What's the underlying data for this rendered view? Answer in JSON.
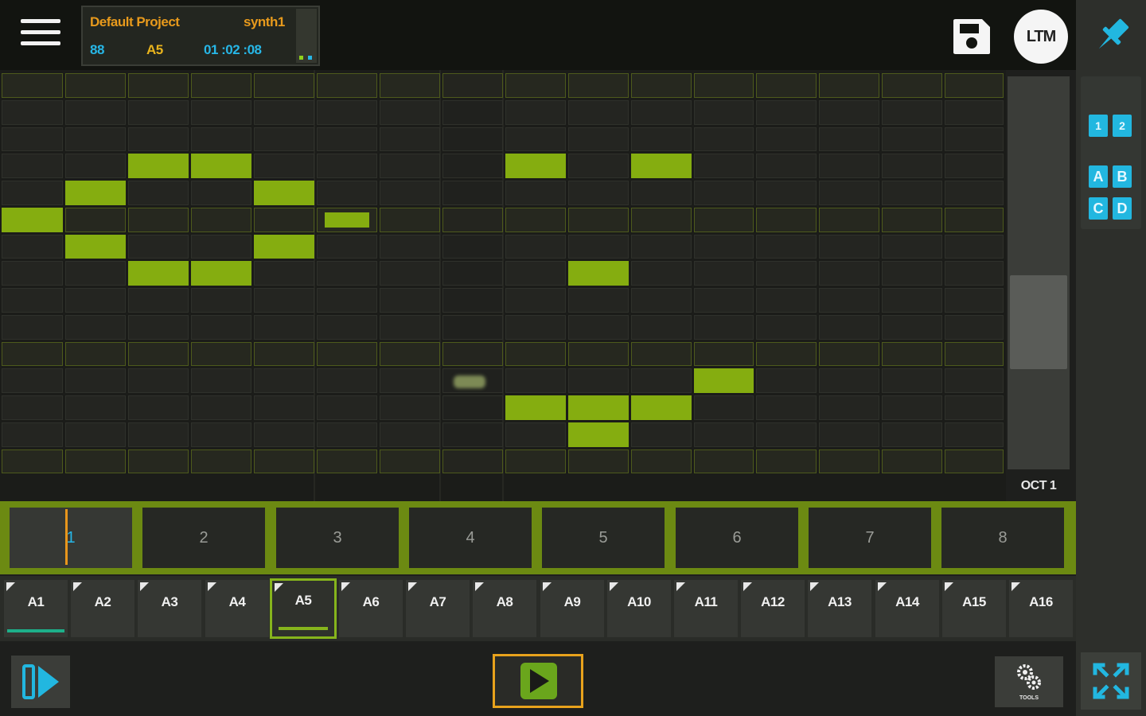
{
  "header": {
    "project_name": "Default Project",
    "instrument": "synth1",
    "bpm": "88",
    "pattern": "A5",
    "time": "01 :02 :08",
    "user_badge": "LTM"
  },
  "right_panel": {
    "page_buttons": [
      "1",
      "2"
    ],
    "bank_buttons": [
      "A",
      "B",
      "C",
      "D"
    ]
  },
  "piano_roll": {
    "rows": 15,
    "steps": 16,
    "notes": [
      {
        "row": 5,
        "step": 0
      },
      {
        "row": 4,
        "step": 1
      },
      {
        "row": 6,
        "step": 1
      },
      {
        "row": 3,
        "step": 2
      },
      {
        "row": 3,
        "step": 3
      },
      {
        "row": 7,
        "step": 2
      },
      {
        "row": 7,
        "step": 3
      },
      {
        "row": 4,
        "step": 4
      },
      {
        "row": 6,
        "step": 4
      },
      {
        "row": 5,
        "step": 5,
        "short": true
      },
      {
        "row": 3,
        "step": 8
      },
      {
        "row": 3,
        "step": 10
      },
      {
        "row": 7,
        "step": 9
      },
      {
        "row": 11,
        "step": 11
      },
      {
        "row": 12,
        "step": 8
      },
      {
        "row": 12,
        "step": 9
      },
      {
        "row": 12,
        "step": 10
      },
      {
        "row": 13,
        "step": 9
      }
    ],
    "octave_label": "OCT 1"
  },
  "bars": [
    "1",
    "2",
    "3",
    "4",
    "5",
    "6",
    "7",
    "8"
  ],
  "active_bar": 0,
  "patterns": [
    "A1",
    "A2",
    "A3",
    "A4",
    "A5",
    "A6",
    "A7",
    "A8",
    "A9",
    "A10",
    "A11",
    "A12",
    "A13",
    "A14",
    "A15",
    "A16"
  ],
  "selected_pattern": 4,
  "playing_pattern": 0,
  "tools_label": "TOOLS",
  "colors": {
    "note": "#85ad10",
    "accent_blue": "#27b6e6",
    "accent_orange": "#e8961c",
    "selection": "#86b41c"
  }
}
